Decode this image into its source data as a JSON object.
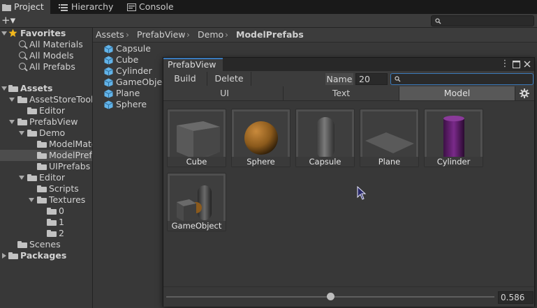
{
  "tabs": [
    {
      "label": "Project",
      "icon": "folder-icon",
      "active": true
    },
    {
      "label": "Hierarchy",
      "icon": "list-icon",
      "active": false
    },
    {
      "label": "Console",
      "icon": "console-icon",
      "active": false
    }
  ],
  "toolbar": {
    "add_label": "+▾",
    "search_placeholder": ""
  },
  "tree": {
    "favorites": {
      "label": "Favorites",
      "items": [
        "All Materials",
        "All Models",
        "All Prefabs"
      ]
    },
    "assets_label": "Assets",
    "asset_store_tools": "AssetStoreTools",
    "editor_1": "Editor",
    "prefab_view": "PrefabView",
    "demo": "Demo",
    "model_materials": "ModelMate",
    "model_prefabs": "ModelPrefa",
    "ui_prefabs": "UIPrefabs",
    "editor_2": "Editor",
    "scripts": "Scripts",
    "textures": "Textures",
    "tex_0": "0",
    "tex_1": "1",
    "tex_2": "2",
    "scenes": "Scenes",
    "packages": "Packages"
  },
  "breadcrumb": {
    "items": [
      "Assets",
      "PrefabView",
      "Demo",
      "ModelPrefabs"
    ]
  },
  "asset_list": [
    "Capsule",
    "Cube",
    "Cylinder",
    "GameObject",
    "Plane",
    "Sphere"
  ],
  "prefab_window": {
    "title": "PrefabView",
    "build_label": "Build",
    "delete_label": "Delete",
    "name_label": "Name",
    "name_value": "20",
    "search_value": "",
    "category_tabs": [
      {
        "label": "UI",
        "active": false
      },
      {
        "label": "Text",
        "active": false
      },
      {
        "label": "Model",
        "active": true
      }
    ],
    "items": [
      {
        "label": "Cube",
        "preview": "cube"
      },
      {
        "label": "Sphere",
        "preview": "sphere"
      },
      {
        "label": "Capsule",
        "preview": "capsule"
      },
      {
        "label": "Plane",
        "preview": "plane"
      },
      {
        "label": "Cylinder",
        "preview": "cylinder"
      },
      {
        "label": "GameObject",
        "preview": "gameobject"
      }
    ],
    "zoom_value": "0.586",
    "zoom_fraction": 0.5
  },
  "colors": {
    "accent": "#3a79bb",
    "favorite_star": "#f2b81d",
    "cube_icon": "#62b3e8",
    "cylinder": "#6a1b7a",
    "sphere": "#8b5a1c"
  }
}
